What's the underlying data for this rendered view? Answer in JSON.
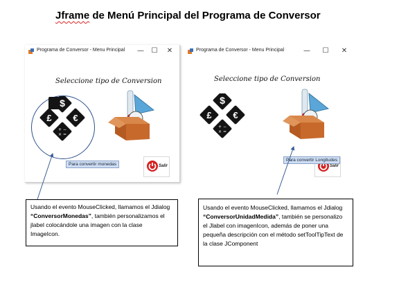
{
  "heading": {
    "first": "Jframe",
    "rest": " de Menú Principal del Programa de Conversor"
  },
  "windows": [
    {
      "title": "Programa de Conversor - Menu Principal",
      "subtitle": "Seleccione tipo de Conversion",
      "tooltip": "Para convertir monedas",
      "exit_label": "Salir",
      "controls": {
        "minimize": "—",
        "maximize": "☐",
        "close": "✕"
      }
    },
    {
      "title": "Programa de Conversor - Menu Principal",
      "subtitle": "Seleccione tipo de Conversion",
      "tooltip": "Para convertir Longitudes",
      "exit_label": "Salir",
      "controls": {
        "minimize": "—",
        "maximize": "☐",
        "close": "✕"
      }
    }
  ],
  "currency_symbols": {
    "top": "$",
    "left": "£",
    "right": "€",
    "ops_top": "+ −",
    "ops_bottom": "× ="
  },
  "notes": [
    {
      "before": "Usando el evento MouseClicked, llamamos el Jdialog ",
      "bold": "“ConversorMonedas”",
      "after": ", también personalizamos el jlabel colocándole una imagen con la clase ImageIcon."
    },
    {
      "before": "Usando el evento MouseClicked, llamamos el Jdialog ",
      "bold": "“ConversorUnidadMedida”",
      "after": ", también se personalizo el Jlabel con imagenIcon, además de poner una pequeña descripción con el método setToolTipText de la clase JComponent"
    }
  ],
  "colors": {
    "tooltip_bg": "#cfddf3",
    "ring": "#2b4f8a",
    "box_brown": "#c8692c",
    "exit_red": "#d42020"
  }
}
